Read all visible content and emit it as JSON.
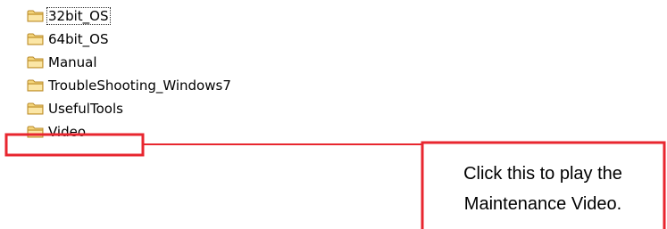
{
  "folders": [
    {
      "name": "32bit_OS",
      "selected": true
    },
    {
      "name": "64bit_OS",
      "selected": false
    },
    {
      "name": "Manual",
      "selected": false
    },
    {
      "name": "TroubleShooting_Windows7",
      "selected": false
    },
    {
      "name": "UsefulTools",
      "selected": false
    },
    {
      "name": "Video",
      "selected": false
    }
  ],
  "callout": {
    "line1": "Click this to play the",
    "line2": "Maintenance Video.",
    "color": "#e8262f"
  },
  "icons": {
    "folder": "folder-icon"
  },
  "colors": {
    "folder_fill": "#f4d57a",
    "folder_edge": "#b8892a"
  }
}
